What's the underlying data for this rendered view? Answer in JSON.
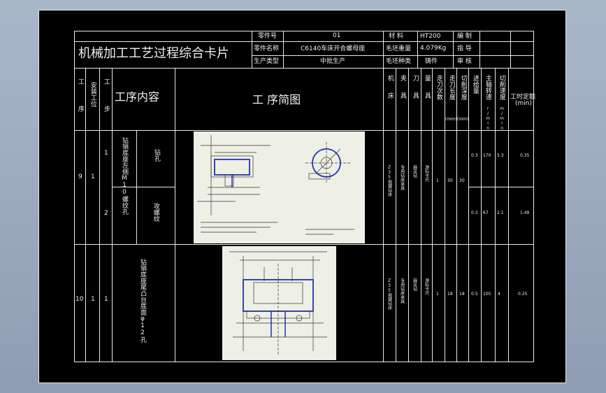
{
  "card_title": "机械加工工艺过程综合卡片",
  "header": {
    "part_no_label": "零件号",
    "part_no_value": "01",
    "part_name_label": "零件名称",
    "part_name_value": "C6140车床开合螺母座",
    "production_type_label": "生产类型",
    "production_type_value": "中批生产",
    "material_label": "材  料",
    "material_value": "HT200",
    "blank_weight_label": "毛坯重量",
    "blank_weight_value": "4.079Kg",
    "blank_type_label": "毛坯种类",
    "blank_type_value": "铸件",
    "compile_label": "编  制",
    "guide_label": "指  导",
    "review_label": "审  核"
  },
  "columns": {
    "process": "工序",
    "install": "安装工位",
    "step": "工步",
    "content": "工序内容",
    "sketch": "工  序简图",
    "machine": "机床",
    "fixture": "夹具",
    "tool": "刀具",
    "gauge": "量具",
    "passes": "走刀次数",
    "length": "走刀长度",
    "depth": "切削深度",
    "mm1": "(mm)",
    "mm2": "(mm)",
    "feed": "进给量",
    "spindle": "主轴转速",
    "spindle_unit": "r/min",
    "speed": "切削速度",
    "speed_unit": "m/min",
    "time_label": "工时定额",
    "time_unit": "(min)"
  },
  "rows": [
    {
      "process": "9",
      "install": "1",
      "content": "钻销底座左侧M10螺纹孔",
      "machine": "Z35摇臂钻床",
      "fixture": "专用钻床夹具",
      "tool": "麻花钻",
      "gauge": "游标卡尺",
      "passes": "1",
      "length": "30",
      "depth": "30",
      "steps": [
        {
          "step": "1",
          "content": "钻孔",
          "feed": "0.3",
          "spindle": "170",
          "speed": "5.3",
          "time": "0.35"
        },
        {
          "step": "2",
          "content": "攻螺纹",
          "feed": "0.3",
          "spindle": "67",
          "speed": "2.1",
          "time": "1.49"
        }
      ]
    },
    {
      "process": "10",
      "install": "1",
      "step": "1",
      "content": "钻销底座尾凸台底面φ12孔",
      "machine": "Z35摇臂钻床",
      "fixture": "专用钻床夹具",
      "tool": "麻花钻",
      "gauge": "游标卡尺",
      "passes": "1",
      "length": "18",
      "depth": "18",
      "feed": "0.5",
      "spindle": "105",
      "speed": "4",
      "time": "0.25"
    }
  ]
}
